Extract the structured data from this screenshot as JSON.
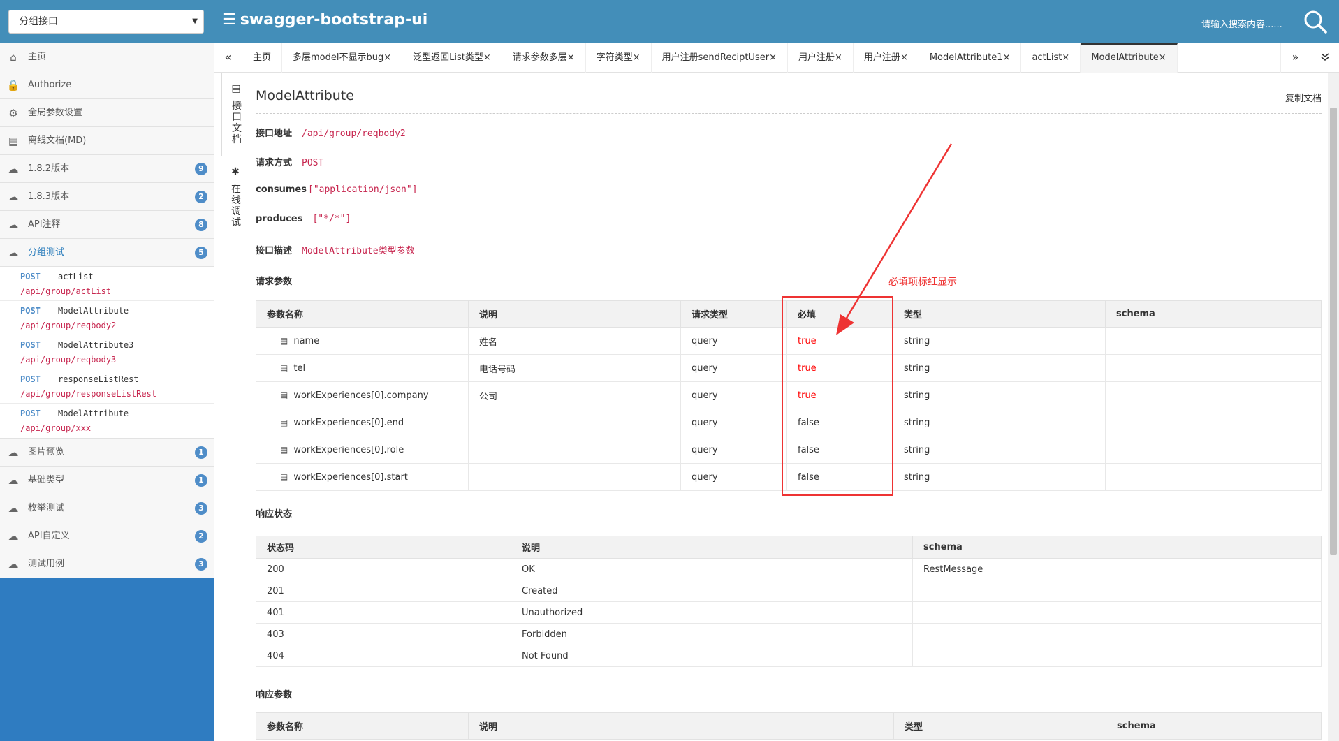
{
  "header": {
    "group_select": "分组接口",
    "brand": "swagger-bootstrap-ui",
    "search_placeholder": "请输入搜索内容......"
  },
  "sidebar": {
    "items": [
      {
        "label": "主页",
        "icon": "home-icon"
      },
      {
        "label": "Authorize",
        "icon": "lock-icon"
      },
      {
        "label": "全局参数设置",
        "icon": "settings-doc-icon"
      },
      {
        "label": "离线文档(MD)",
        "icon": "document-icon"
      },
      {
        "label": "1.8.2版本",
        "icon": "cloud-icon",
        "badge": "9"
      },
      {
        "label": "1.8.3版本",
        "icon": "cloud-icon",
        "badge": "2"
      },
      {
        "label": "API注释",
        "icon": "cloud-icon",
        "badge": "8"
      },
      {
        "label": "分组测试",
        "icon": "cloud-icon",
        "badge": "5",
        "active": true
      }
    ],
    "sub_items": [
      {
        "method": "POST",
        "name": "actList",
        "path": "/api/group/actList"
      },
      {
        "method": "POST",
        "name": "ModelAttribute",
        "path": "/api/group/reqbody2"
      },
      {
        "method": "POST",
        "name": "ModelAttribute3",
        "path": "/api/group/reqbody3"
      },
      {
        "method": "POST",
        "name": "responseListRest",
        "path": "/api/group/responseListRest"
      },
      {
        "method": "POST",
        "name": "ModelAttribute",
        "path": "/api/group/xxx"
      }
    ],
    "items_after": [
      {
        "label": "图片预览",
        "icon": "cloud-icon",
        "badge": "1"
      },
      {
        "label": "基础类型",
        "icon": "cloud-icon",
        "badge": "1"
      },
      {
        "label": "枚举测试",
        "icon": "cloud-icon",
        "badge": "3"
      },
      {
        "label": "API自定义",
        "icon": "cloud-icon",
        "badge": "2"
      },
      {
        "label": "测试用例",
        "icon": "cloud-icon",
        "badge": "3"
      }
    ]
  },
  "tabs": {
    "items": [
      {
        "label": "主页",
        "closable": false
      },
      {
        "label": "多层model不显示bug",
        "closable": true
      },
      {
        "label": "泛型返回List类型",
        "closable": true
      },
      {
        "label": "请求参数多层",
        "closable": true
      },
      {
        "label": "字符类型",
        "closable": true
      },
      {
        "label": "用户注册sendReciptUser",
        "closable": true
      },
      {
        "label": "用户注册",
        "closable": true
      },
      {
        "label": "用户注册",
        "closable": true
      },
      {
        "label": "ModelAttribute1",
        "closable": true
      },
      {
        "label": "actList",
        "closable": true
      },
      {
        "label": "ModelAttribute",
        "closable": true,
        "active": true
      }
    ],
    "close_glyph": "×",
    "nav_left": "«",
    "nav_right": "»",
    "nav_drop": "⌄"
  },
  "vtabs": {
    "doc": "接口文档",
    "debug": "在线调试"
  },
  "doc": {
    "title": "ModelAttribute",
    "copy": "复制文档",
    "fields": {
      "url_label": "接口地址",
      "url": "/api/group/reqbody2",
      "method_label": "请求方式",
      "method": "POST",
      "consumes_label": "consumes",
      "consumes": "[\"application/json\"]",
      "produces_label": "produces",
      "produces": "[\"*/*\"]",
      "desc_label": "接口描述",
      "desc": "ModelAttribute类型参数"
    },
    "req_label": "请求参数",
    "req_headers": [
      "参数名称",
      "说明",
      "请求类型",
      "必填",
      "类型",
      "schema"
    ],
    "req_rows": [
      {
        "name": "name",
        "desc": "姓名",
        "in": "query",
        "required": "true",
        "type": "string",
        "schema": ""
      },
      {
        "name": "tel",
        "desc": "电话号码",
        "in": "query",
        "required": "true",
        "type": "string",
        "schema": ""
      },
      {
        "name": "workExperiences[0].company",
        "desc": "公司",
        "in": "query",
        "required": "true",
        "type": "string",
        "schema": ""
      },
      {
        "name": "workExperiences[0].end",
        "desc": "",
        "in": "query",
        "required": "false",
        "type": "string",
        "schema": ""
      },
      {
        "name": "workExperiences[0].role",
        "desc": "",
        "in": "query",
        "required": "false",
        "type": "string",
        "schema": ""
      },
      {
        "name": "workExperiences[0].start",
        "desc": "",
        "in": "query",
        "required": "false",
        "type": "string",
        "schema": ""
      }
    ],
    "resp_status_label": "响应状态",
    "resp_headers": [
      "状态码",
      "说明",
      "schema"
    ],
    "resp_rows": [
      {
        "code": "200",
        "desc": "OK",
        "schema": "RestMessage"
      },
      {
        "code": "201",
        "desc": "Created",
        "schema": ""
      },
      {
        "code": "401",
        "desc": "Unauthorized",
        "schema": ""
      },
      {
        "code": "403",
        "desc": "Forbidden",
        "schema": ""
      },
      {
        "code": "404",
        "desc": "Not Found",
        "schema": ""
      }
    ],
    "resp_params_label": "响应参数",
    "resp_param_headers": [
      "参数名称",
      "说明",
      "类型",
      "schema"
    ]
  },
  "annotation": {
    "text": "必填项标红显示",
    "color": "#ee3333"
  }
}
